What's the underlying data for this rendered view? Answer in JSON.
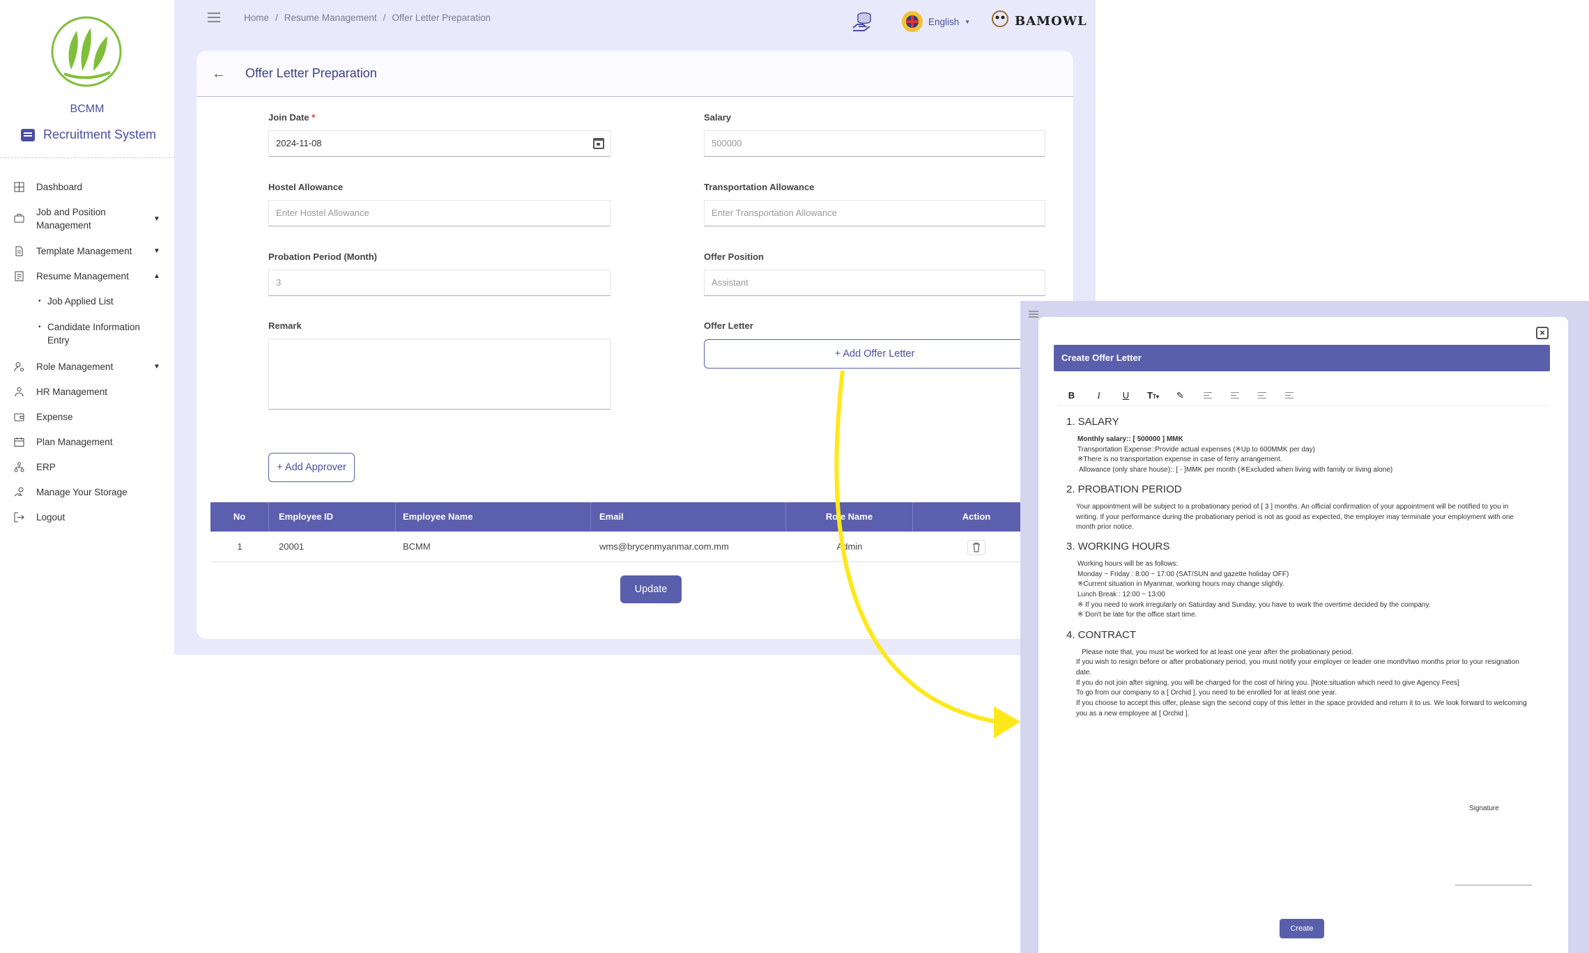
{
  "sidebar": {
    "brand": "BCMM",
    "system_title": "Recruitment System",
    "items": [
      {
        "label": "Dashboard"
      },
      {
        "label": "Job and Position Management"
      },
      {
        "label": "Template Management"
      },
      {
        "label": "Resume Management"
      },
      {
        "label": "Role Management"
      },
      {
        "label": "HR Management"
      },
      {
        "label": "Expense"
      },
      {
        "label": "Plan Management"
      },
      {
        "label": "ERP"
      },
      {
        "label": "Manage Your Storage"
      },
      {
        "label": "Logout"
      }
    ],
    "sub_items": [
      {
        "label": "Job Applied List"
      },
      {
        "label": "Candidate Information Entry"
      }
    ]
  },
  "topbar": {
    "breadcrumb": [
      "Home",
      "Resume Management",
      "Offer Letter Preparation"
    ],
    "language": "English",
    "logo_text": "BAMOWL"
  },
  "page": {
    "title": "Offer Letter Preparation",
    "fields": {
      "join_date": {
        "label": "Join Date",
        "value": "2024-11-08"
      },
      "salary": {
        "label": "Salary",
        "placeholder": "500000"
      },
      "hostel": {
        "label": "Hostel Allowance",
        "placeholder": "Enter Hostel Allowance"
      },
      "transport": {
        "label": "Transportation Allowance",
        "placeholder": "Enter Transportation Allowance"
      },
      "probation": {
        "label": "Probation Period (Month)",
        "placeholder": "3"
      },
      "position": {
        "label": "Offer Position",
        "placeholder": "Assistant"
      },
      "remark": {
        "label": "Remark"
      },
      "offer_letter": {
        "label": "Offer Letter"
      }
    },
    "add_offer_label": "+ Add Offer Letter",
    "add_approver_label": "+ Add Approver",
    "table": {
      "headers": [
        "No",
        "Employee ID",
        "Employee Name",
        "Email",
        "Role Name",
        "Action"
      ],
      "rows": [
        {
          "no": "1",
          "employee_id": "20001",
          "employee_name": "BCMM",
          "email": "wms@brycenmyanmar.com.mm",
          "role": "Admin"
        }
      ]
    },
    "update_label": "Update"
  },
  "modal": {
    "title": "Create Offer Letter",
    "create_label": "Create",
    "sections": [
      {
        "heading": "1. SALARY",
        "lines": [
          "Monthly salary:: [ 500000 ] MMK",
          "Transportation Expense::Provide actual expenses (※Up to 600MMK per day)",
          "※There is no transportation expense in case of ferry arrangement.",
          "Allowance (only share house):: [ - ]MMK per month (※Excluded when living with family or living alone)"
        ]
      },
      {
        "heading": "2. PROBATION PERIOD",
        "lines": [
          "Your appointment will be subject to a probationary period of [ 3 ] months. An official confirmation of your appointment will be notified to you in",
          "writing. If your performance during the probationary period is not as good as expected, the employer may terminate your employment with one",
          "month prior notice."
        ]
      },
      {
        "heading": "3. WORKING HOURS",
        "lines": [
          "Working hours will be as follows:",
          "Monday ~ Friday : 8:00 ~ 17:00 (SAT/SUN and gazette holiday OFF)",
          "※Current situation in Myanmar, working hours may change slightly.",
          "Lunch Break : 12:00 ~ 13:00",
          "※ If you need to work irregularly on Saturday and Sunday, you have to work the overtime decided by the company.",
          "※ Don't be late for the office start time."
        ]
      },
      {
        "heading": "4. CONTRACT",
        "lines": [
          "Please note that, you must be worked for at least one year after the probationary period.",
          "If you wish to resign before or after probationary period, you must notify your employer or leader one month/two months prior to your resignation",
          "date.",
          "If you do not join after signing, you will be charged for the cost of hiring you. [Note:situation which need to give Agency Fees]",
          "To go from our company to a [ Orchid ], you need to be enrolled for at least one year.",
          "If you choose to accept this offer, please sign the second copy of this letter in the space provided and return it to us. We look forward to welcoming",
          "you as a new employee at [ Orchid ]."
        ]
      }
    ],
    "signature_label": "Signature"
  },
  "colors": {
    "primary": "#5a5fab",
    "main_bg": "#e8e9fb",
    "arrow": "#ffe81a"
  }
}
